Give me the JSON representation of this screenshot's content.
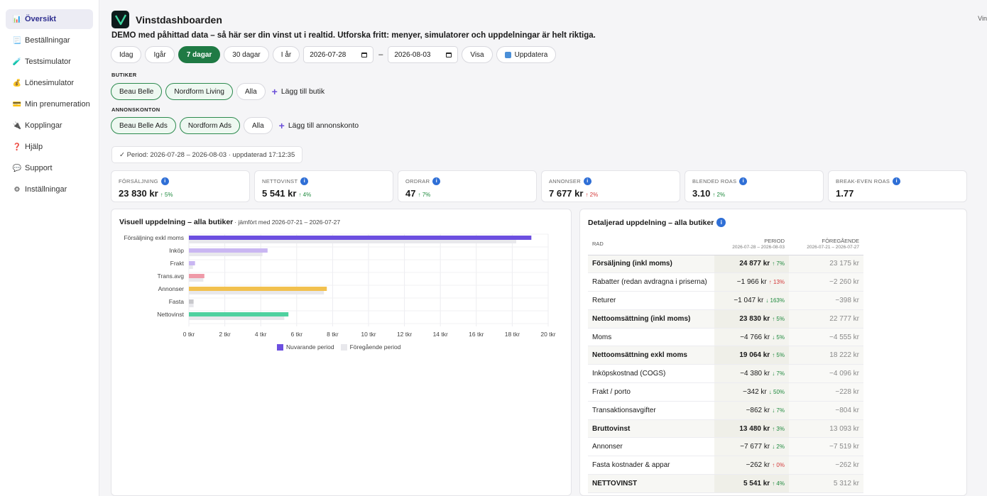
{
  "sidebar": {
    "items": [
      {
        "label": "Översikt",
        "icon": "📊",
        "active": true
      },
      {
        "label": "Beställningar",
        "icon": "📃"
      },
      {
        "label": "Testsimulator",
        "icon": "🧪"
      },
      {
        "label": "Lönesimulator",
        "icon": "💰"
      },
      {
        "label": "Min prenumeration",
        "icon": "💳"
      },
      {
        "label": "Kopplingar",
        "icon": "🔌"
      },
      {
        "label": "Hjälp",
        "icon": "❓"
      },
      {
        "label": "Support",
        "icon": "💬"
      },
      {
        "label": "Inställningar",
        "icon": "⚙"
      }
    ]
  },
  "topright_text": "Vin",
  "header": {
    "title": "Vinstdashboarden",
    "subtitle": "DEMO med påhittad data – så här ser din vinst ut i realtid. Utforska fritt: menyer, simulatorer och uppdelningar är helt riktiga."
  },
  "range": {
    "buttons": [
      "Idag",
      "Igår",
      "7 dagar",
      "30 dagar",
      "I år"
    ],
    "active": "7 dagar",
    "date_from": "2026-07-28",
    "date_to": "2026-08-03",
    "dash": "–",
    "show_label": "Visa",
    "refresh_label": "Uppdatera"
  },
  "stores": {
    "label": "BUTIKER",
    "chips": [
      "Beau Belle",
      "Nordform Living"
    ],
    "all": "Alla",
    "add": "Lägg till butik"
  },
  "ad_accounts": {
    "label": "ANNONSKONTON",
    "chips": [
      "Beau Belle Ads",
      "Nordform Ads"
    ],
    "all": "Alla",
    "add": "Lägg till annonskonto"
  },
  "period_status": "✓ Period: 2026-07-28 – 2026-08-03 · uppdaterad 17:12:35",
  "kpis": [
    {
      "label": "FÖRSÄLJNING",
      "value": "23 830 kr",
      "delta": "↑ 5%",
      "dir": "up"
    },
    {
      "label": "NETTOVINST",
      "value": "5 541 kr",
      "delta": "↑ 4%",
      "dir": "up"
    },
    {
      "label": "ORDRAR",
      "value": "47",
      "delta": "↑ 7%",
      "dir": "up"
    },
    {
      "label": "ANNONSER",
      "value": "7 677 kr",
      "delta": "↑ 2%",
      "dir": "down"
    },
    {
      "label": "BLENDED ROAS",
      "value": "3.10",
      "delta": "↑ 2%",
      "dir": "up"
    },
    {
      "label": "BREAK-EVEN ROAS",
      "value": "1.77",
      "delta": "",
      "dir": "up"
    }
  ],
  "chart_panel": {
    "title": "Visuell uppdelning – alla butiker",
    "compare": "· jämfört med 2026-07-21 – 2026-07-27"
  },
  "chart_data": {
    "type": "bar",
    "orientation": "horizontal",
    "categories": [
      "Försäljning exkl moms",
      "Inköp",
      "Frakt",
      "Trans.avg",
      "Annonser",
      "Fasta",
      "Nettovinst"
    ],
    "series": [
      {
        "name": "Nuvarande period",
        "values": [
          19064,
          4380,
          342,
          862,
          7677,
          262,
          5541
        ],
        "colors": [
          "#6c4fe0",
          "#c9b6f2",
          "#c9b6f2",
          "#ef9aa8",
          "#f2c14e",
          "#c8c8cc",
          "#4fd1a0"
        ]
      },
      {
        "name": "Föregående period",
        "values": [
          18222,
          4096,
          228,
          804,
          7519,
          262,
          5312
        ],
        "color": "#e8e8ec"
      }
    ],
    "x_ticks": [
      "0 tkr",
      "2 tkr",
      "4 tkr",
      "6 tkr",
      "8 tkr",
      "10 tkr",
      "12 tkr",
      "14 tkr",
      "16 tkr",
      "18 tkr",
      "20 tkr"
    ],
    "xlim": [
      0,
      20000
    ],
    "grid": true,
    "legend_position": "bottom"
  },
  "table_panel": {
    "title": "Detaljerad uppdelning – alla butiker",
    "col_row": "RAD",
    "col_period": "PERIOD",
    "col_period_sub": "2026-07-28 – 2026-08-03",
    "col_prev": "FÖREGÅENDE",
    "col_prev_sub": "2026-07-21 – 2026-07-27",
    "rows": [
      {
        "label": "Försäljning (inkl moms)",
        "period": "24 877 kr",
        "delta": "↑ 7%",
        "dir": "up",
        "prev": "23 175 kr",
        "bold": true
      },
      {
        "label": "Rabatter (redan avdragna i priserna)",
        "period": "−1 966 kr",
        "delta": "↑ 13%",
        "dir": "down",
        "prev": "−2 260 kr",
        "bold": false
      },
      {
        "label": "Returer",
        "period": "−1 047 kr",
        "delta": "↓ 163%",
        "dir": "up",
        "prev": "−398 kr",
        "bold": false
      },
      {
        "label": "Nettoomsättning (inkl moms)",
        "period": "23 830 kr",
        "delta": "↑ 5%",
        "dir": "up",
        "prev": "22 777 kr",
        "bold": true
      },
      {
        "label": "Moms",
        "period": "−4 766 kr",
        "delta": "↓ 5%",
        "dir": "up",
        "prev": "−4 555 kr",
        "bold": false
      },
      {
        "label": "Nettoomsättning exkl moms",
        "period": "19 064 kr",
        "delta": "↑ 5%",
        "dir": "up",
        "prev": "18 222 kr",
        "bold": true
      },
      {
        "label": "Inköpskostnad (COGS)",
        "period": "−4 380 kr",
        "delta": "↓ 7%",
        "dir": "up",
        "prev": "−4 096 kr",
        "bold": false
      },
      {
        "label": "Frakt / porto",
        "period": "−342 kr",
        "delta": "↓ 50%",
        "dir": "up",
        "prev": "−228 kr",
        "bold": false
      },
      {
        "label": "Transaktionsavgifter",
        "period": "−862 kr",
        "delta": "↓ 7%",
        "dir": "up",
        "prev": "−804 kr",
        "bold": false
      },
      {
        "label": "Bruttovinst",
        "period": "13 480 kr",
        "delta": "↑ 3%",
        "dir": "up",
        "prev": "13 093 kr",
        "bold": true
      },
      {
        "label": "Annonser",
        "period": "−7 677 kr",
        "delta": "↓ 2%",
        "dir": "up",
        "prev": "−7 519 kr",
        "bold": false
      },
      {
        "label": "Fasta kostnader & appar",
        "period": "−262 kr",
        "delta": "↑ 0%",
        "dir": "down",
        "prev": "−262 kr",
        "bold": false
      },
      {
        "label": "NETTOVINST",
        "period": "5 541 kr",
        "delta": "↑ 4%",
        "dir": "up",
        "prev": "5 312 kr",
        "bold": true
      }
    ]
  }
}
